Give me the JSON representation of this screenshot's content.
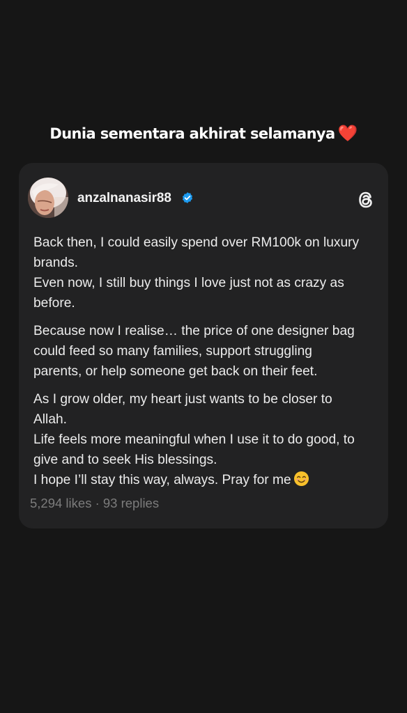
{
  "story": {
    "caption": "Dunia sementara akhirat selamanya",
    "caption_emoji": "❤️"
  },
  "post": {
    "username": "anzalnanasir88",
    "verified": true,
    "app_icon": "threads-icon",
    "paragraphs": [
      [
        "Back then, I could easily spend over RM100k on luxury",
        "brands.",
        "Even now, I still buy things I love just not as crazy as",
        "before."
      ],
      [
        "Because now I realise… the price of one designer bag",
        "could feed so many families, support struggling",
        "parents, or help someone get back on their feet."
      ],
      [
        "As I grow older, my heart just wants to be closer to",
        "Allah.",
        "Life feels more meaningful when I use it to do good, to",
        "give and to seek His blessings.",
        "I  hope I’ll stay this way, always. Pray for me"
      ]
    ],
    "stats": "5,294 likes · 93 replies"
  },
  "colors": {
    "background": "#161616",
    "card": "#222223",
    "verified_badge": "#1d9bf0",
    "heart": "#e0202e"
  }
}
